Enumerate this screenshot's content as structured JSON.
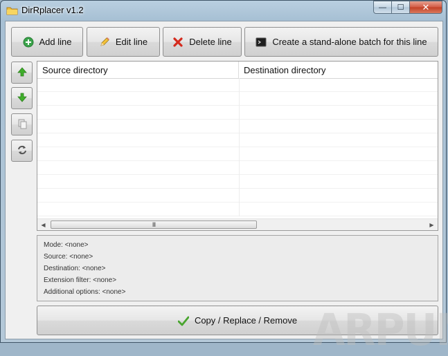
{
  "window": {
    "title": "DirRplacer v1.2",
    "controls": {
      "minimize": "—",
      "maximize": "☐",
      "close": "✕"
    }
  },
  "toolbar": {
    "add_label": "Add line",
    "edit_label": "Edit line",
    "delete_label": "Delete line",
    "batch_label": "Create a stand-alone batch for this line"
  },
  "side_tools": [
    "move-up",
    "move-down",
    "copy",
    "refresh"
  ],
  "table": {
    "columns": [
      "Source directory",
      "Destination directory"
    ],
    "rows": []
  },
  "scrollbar": {
    "left": "◀",
    "right": "▶",
    "grip": "III"
  },
  "info": {
    "mode": "Mode: <none>",
    "source": "Source: <none>",
    "destination": "Destination: <none>",
    "extension_filter": "Extension filter: <none>",
    "additional_options": "Additional options: <none>"
  },
  "action": {
    "copy_label": "Copy / Replace / Remove"
  },
  "watermark": "ARPUN",
  "colors": {
    "add": "#3aa34a",
    "delete": "#d42a1d",
    "arrow": "#3fae2a",
    "check": "#49a52f"
  }
}
